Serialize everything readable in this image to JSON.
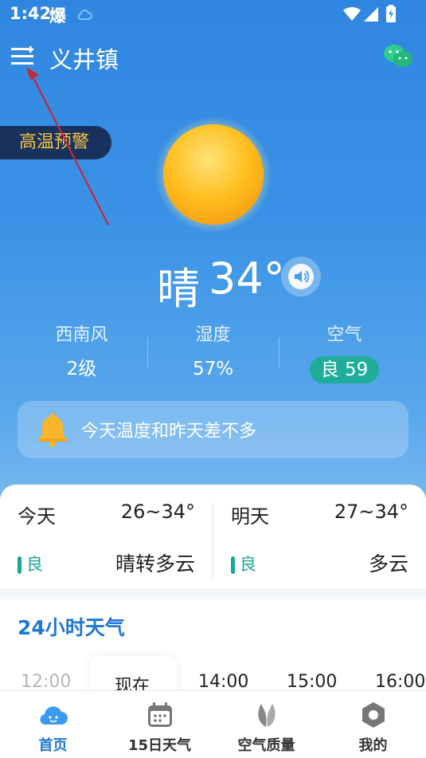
{
  "status_bar": {
    "time": "1:42",
    "app_indicator": "爆"
  },
  "header": {
    "location": "义井镇"
  },
  "alert": {
    "label": "高温预警"
  },
  "current": {
    "condition": "晴",
    "temperature": "34°"
  },
  "stats": {
    "wind": {
      "label": "西南风",
      "value": "2级"
    },
    "humidity": {
      "label": "湿度",
      "value": "57%"
    },
    "air": {
      "label": "空气",
      "value": "良 59"
    }
  },
  "tip": {
    "text": "今天温度和昨天差不多"
  },
  "days": [
    {
      "name": "今天",
      "range": "26~34°",
      "aq": "良",
      "desc": "晴转多云"
    },
    {
      "name": "明天",
      "range": "27~34°",
      "aq": "良",
      "desc": "多云"
    }
  ],
  "hourly": {
    "title": "24小时天气",
    "hours": [
      "12:00",
      "现在",
      "14:00",
      "15:00",
      "16:00"
    ]
  },
  "nav": {
    "items": [
      {
        "label": "首页"
      },
      {
        "label": "15日天气"
      },
      {
        "label": "空气质量"
      },
      {
        "label": "我的"
      }
    ],
    "active": "首页"
  },
  "colors": {
    "accent": "#1f77d6",
    "aqi_good": "#1aa896",
    "alert_text": "#f7c340",
    "annotation_arrow": "#c8283c"
  },
  "icons": [
    "menu-icon",
    "wechat-icon",
    "sun-icon",
    "speaker-icon",
    "bell-icon",
    "home-weather-icon",
    "calendar-icon",
    "leaf-icon",
    "hexagon-profile-icon"
  ]
}
